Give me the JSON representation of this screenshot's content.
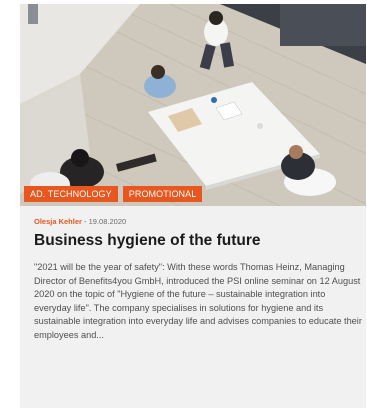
{
  "article": {
    "tags": [
      "AD. TECHNOLOGY",
      "PROMOTIONAL"
    ],
    "author": "Olesja Kehler",
    "separator": " - ",
    "date": "19.08.2020",
    "title": "Business hygiene of the future",
    "excerpt": "\"2021 will be the year of safety\": With these words Thomas Heinz, Managing Director of Benefits4you GmbH, introduced the PSI online seminar on 12 August 2020 on the topic of \"Hygiene of the future – sustainable integration into everyday life\". The company specialises in solutions for hygiene and its sustainable integration into everyday life and advises companies to educate their employees and..."
  },
  "colors": {
    "accent": "#e8571f",
    "card_background": "#f1f1f2",
    "title_text": "#1b1b1b",
    "body_text": "#4f4f4f"
  },
  "image": {
    "depicts": "overhead-photo-meeting-table"
  }
}
